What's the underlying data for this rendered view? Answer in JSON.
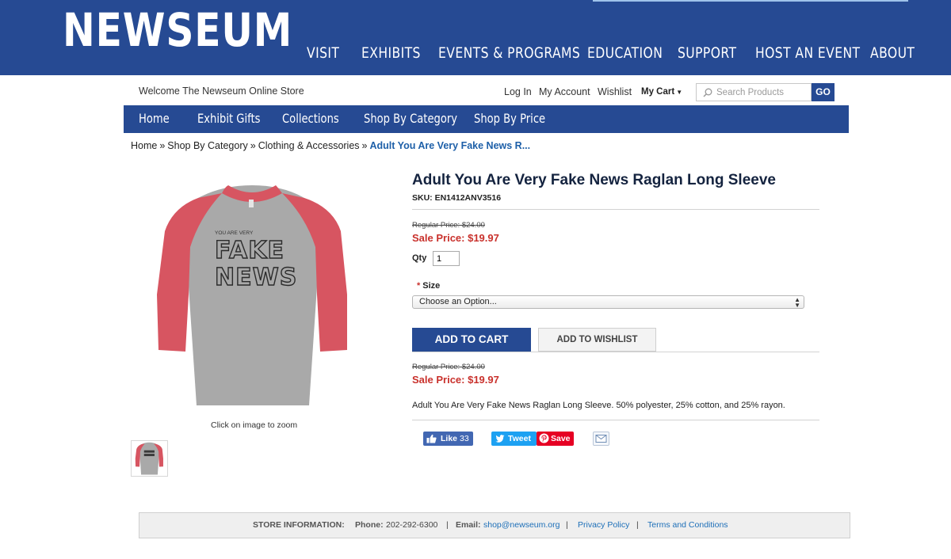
{
  "site": {
    "logo": "NEWSEUM",
    "nav": [
      "VISIT",
      "EXHIBITS",
      "EVENTS & PROGRAMS",
      "EDUCATION",
      "SUPPORT",
      "HOST AN EVENT",
      "ABOUT"
    ]
  },
  "store_bar": {
    "welcome": "Welcome The Newseum Online Store",
    "login": "Log In",
    "account": "My Account",
    "wishlist": "Wishlist",
    "cart": "My Cart",
    "search_placeholder": "Search Products",
    "go": "GO"
  },
  "store_nav": [
    "Home",
    "Exhibit Gifts",
    "Collections",
    "Shop By Category",
    "Shop By Price"
  ],
  "breadcrumb": {
    "items": [
      "Home",
      "Shop By Category",
      "Clothing & Accessories"
    ],
    "separator": "»",
    "current": "Adult You Are Very Fake News R..."
  },
  "product": {
    "image_alt": "Raglan long sleeve shirt",
    "shirt_text_small": "YOU ARE VERY",
    "shirt_text_line1": "FAKE",
    "shirt_text_line2": "NEWS",
    "zoom_note": "Click on image to zoom",
    "title": "Adult You Are Very Fake News Raglan Long Sleeve",
    "sku": "SKU: EN1412ANV3516",
    "regular_price": "Regular Price: $24.00",
    "sale_price": "Sale Price: $19.97",
    "qty_label": "Qty",
    "qty_value": "1",
    "size_required": "*",
    "size_label": "Size",
    "size_selected": "Choose an Option...",
    "add_to_cart": "ADD TO CART",
    "add_to_wishlist": "ADD TO WISHLIST",
    "description": "Adult You Are Very Fake News Raglan Long Sleeve. 50% polyester, 25% cotton, and 25% rayon."
  },
  "social": {
    "like_label": "Like",
    "like_count": "33",
    "tweet_label": "Tweet",
    "save_label": "Save"
  },
  "footer": {
    "store_info_label": "STORE INFORMATION:",
    "phone_label": "Phone:",
    "phone": "202-292-6300",
    "email_label": "Email:",
    "email": "shop@newseum.org",
    "privacy": "Privacy Policy",
    "terms": "Terms and Conditions",
    "separator": "|"
  },
  "colors": {
    "brand_blue": "#264a93",
    "sale_red": "#c9312c",
    "link_blue": "#1d5fa8",
    "shirt_red": "#d75561",
    "shirt_gray": "#a9a9a9"
  }
}
